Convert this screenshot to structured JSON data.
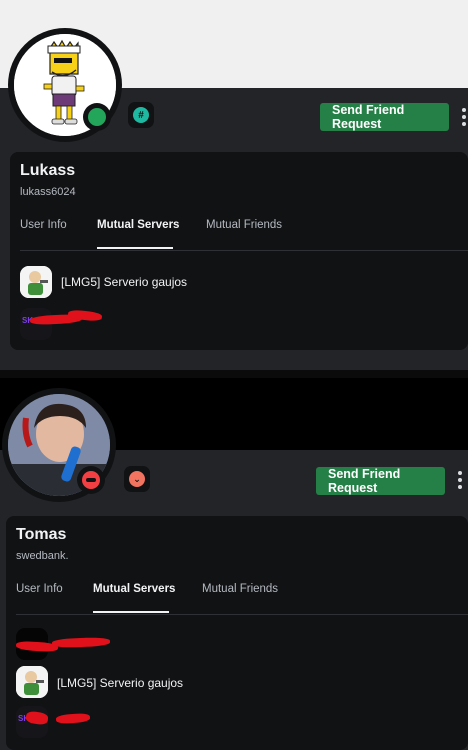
{
  "profiles": [
    {
      "display_name": "Lukass",
      "username": "lukass6024",
      "friend_button": "Send Friend Request",
      "status": "online",
      "tabs": [
        {
          "label": "User Info",
          "active": false
        },
        {
          "label": "Mutual Servers",
          "active": true
        },
        {
          "label": "Mutual Friends",
          "active": false
        }
      ],
      "servers": [
        {
          "name": "[LMG5] Serverio gaujos",
          "icon": "character-server-icon"
        },
        {
          "name": "",
          "icon": "sk-server-icon",
          "redacted": true
        }
      ]
    },
    {
      "display_name": "Tomas",
      "username": "swedbank.",
      "friend_button": "Send Friend Request",
      "status": "do-not-disturb",
      "tabs": [
        {
          "label": "User Info",
          "active": false
        },
        {
          "label": "Mutual Servers",
          "active": true
        },
        {
          "label": "Mutual Friends",
          "active": false
        }
      ],
      "servers": [
        {
          "name": "",
          "icon": "black-server-icon",
          "redacted": true
        },
        {
          "name": "[LMG5] Serverio gaujos",
          "icon": "character-server-icon"
        },
        {
          "name": "",
          "icon": "sk-server-icon",
          "redacted": true
        }
      ]
    }
  ],
  "colors": {
    "friend_button": "#248046",
    "online": "#23a55a",
    "dnd": "#f23f43",
    "redaction": "#e0111a"
  }
}
